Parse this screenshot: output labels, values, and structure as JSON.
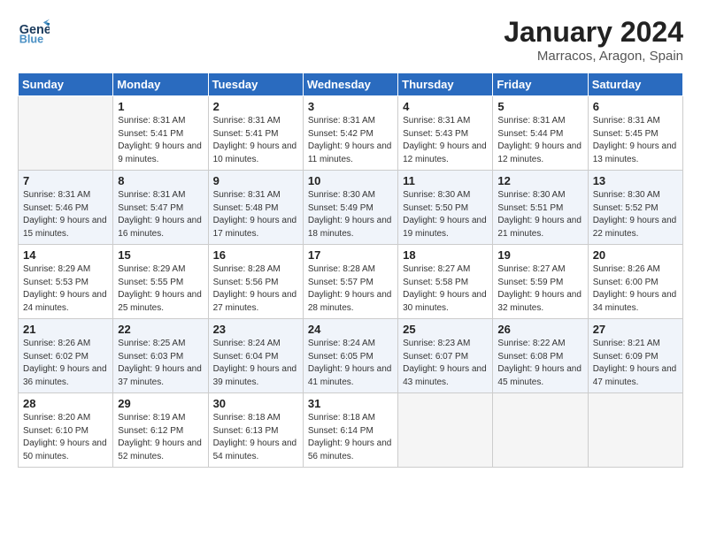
{
  "header": {
    "logo_line1": "General",
    "logo_line2": "Blue",
    "title": "January 2024",
    "subtitle": "Marracos, Aragon, Spain"
  },
  "calendar": {
    "days": [
      "Sunday",
      "Monday",
      "Tuesday",
      "Wednesday",
      "Thursday",
      "Friday",
      "Saturday"
    ],
    "rows": [
      [
        {
          "day": "",
          "empty": true
        },
        {
          "day": "1",
          "sunrise": "Sunrise: 8:31 AM",
          "sunset": "Sunset: 5:41 PM",
          "daylight": "Daylight: 9 hours and 9 minutes."
        },
        {
          "day": "2",
          "sunrise": "Sunrise: 8:31 AM",
          "sunset": "Sunset: 5:41 PM",
          "daylight": "Daylight: 9 hours and 10 minutes."
        },
        {
          "day": "3",
          "sunrise": "Sunrise: 8:31 AM",
          "sunset": "Sunset: 5:42 PM",
          "daylight": "Daylight: 9 hours and 11 minutes."
        },
        {
          "day": "4",
          "sunrise": "Sunrise: 8:31 AM",
          "sunset": "Sunset: 5:43 PM",
          "daylight": "Daylight: 9 hours and 12 minutes."
        },
        {
          "day": "5",
          "sunrise": "Sunrise: 8:31 AM",
          "sunset": "Sunset: 5:44 PM",
          "daylight": "Daylight: 9 hours and 12 minutes."
        },
        {
          "day": "6",
          "sunrise": "Sunrise: 8:31 AM",
          "sunset": "Sunset: 5:45 PM",
          "daylight": "Daylight: 9 hours and 13 minutes."
        }
      ],
      [
        {
          "day": "7",
          "sunrise": "Sunrise: 8:31 AM",
          "sunset": "Sunset: 5:46 PM",
          "daylight": "Daylight: 9 hours and 15 minutes."
        },
        {
          "day": "8",
          "sunrise": "Sunrise: 8:31 AM",
          "sunset": "Sunset: 5:47 PM",
          "daylight": "Daylight: 9 hours and 16 minutes."
        },
        {
          "day": "9",
          "sunrise": "Sunrise: 8:31 AM",
          "sunset": "Sunset: 5:48 PM",
          "daylight": "Daylight: 9 hours and 17 minutes."
        },
        {
          "day": "10",
          "sunrise": "Sunrise: 8:30 AM",
          "sunset": "Sunset: 5:49 PM",
          "daylight": "Daylight: 9 hours and 18 minutes."
        },
        {
          "day": "11",
          "sunrise": "Sunrise: 8:30 AM",
          "sunset": "Sunset: 5:50 PM",
          "daylight": "Daylight: 9 hours and 19 minutes."
        },
        {
          "day": "12",
          "sunrise": "Sunrise: 8:30 AM",
          "sunset": "Sunset: 5:51 PM",
          "daylight": "Daylight: 9 hours and 21 minutes."
        },
        {
          "day": "13",
          "sunrise": "Sunrise: 8:30 AM",
          "sunset": "Sunset: 5:52 PM",
          "daylight": "Daylight: 9 hours and 22 minutes."
        }
      ],
      [
        {
          "day": "14",
          "sunrise": "Sunrise: 8:29 AM",
          "sunset": "Sunset: 5:53 PM",
          "daylight": "Daylight: 9 hours and 24 minutes."
        },
        {
          "day": "15",
          "sunrise": "Sunrise: 8:29 AM",
          "sunset": "Sunset: 5:55 PM",
          "daylight": "Daylight: 9 hours and 25 minutes."
        },
        {
          "day": "16",
          "sunrise": "Sunrise: 8:28 AM",
          "sunset": "Sunset: 5:56 PM",
          "daylight": "Daylight: 9 hours and 27 minutes."
        },
        {
          "day": "17",
          "sunrise": "Sunrise: 8:28 AM",
          "sunset": "Sunset: 5:57 PM",
          "daylight": "Daylight: 9 hours and 28 minutes."
        },
        {
          "day": "18",
          "sunrise": "Sunrise: 8:27 AM",
          "sunset": "Sunset: 5:58 PM",
          "daylight": "Daylight: 9 hours and 30 minutes."
        },
        {
          "day": "19",
          "sunrise": "Sunrise: 8:27 AM",
          "sunset": "Sunset: 5:59 PM",
          "daylight": "Daylight: 9 hours and 32 minutes."
        },
        {
          "day": "20",
          "sunrise": "Sunrise: 8:26 AM",
          "sunset": "Sunset: 6:00 PM",
          "daylight": "Daylight: 9 hours and 34 minutes."
        }
      ],
      [
        {
          "day": "21",
          "sunrise": "Sunrise: 8:26 AM",
          "sunset": "Sunset: 6:02 PM",
          "daylight": "Daylight: 9 hours and 36 minutes."
        },
        {
          "day": "22",
          "sunrise": "Sunrise: 8:25 AM",
          "sunset": "Sunset: 6:03 PM",
          "daylight": "Daylight: 9 hours and 37 minutes."
        },
        {
          "day": "23",
          "sunrise": "Sunrise: 8:24 AM",
          "sunset": "Sunset: 6:04 PM",
          "daylight": "Daylight: 9 hours and 39 minutes."
        },
        {
          "day": "24",
          "sunrise": "Sunrise: 8:24 AM",
          "sunset": "Sunset: 6:05 PM",
          "daylight": "Daylight: 9 hours and 41 minutes."
        },
        {
          "day": "25",
          "sunrise": "Sunrise: 8:23 AM",
          "sunset": "Sunset: 6:07 PM",
          "daylight": "Daylight: 9 hours and 43 minutes."
        },
        {
          "day": "26",
          "sunrise": "Sunrise: 8:22 AM",
          "sunset": "Sunset: 6:08 PM",
          "daylight": "Daylight: 9 hours and 45 minutes."
        },
        {
          "day": "27",
          "sunrise": "Sunrise: 8:21 AM",
          "sunset": "Sunset: 6:09 PM",
          "daylight": "Daylight: 9 hours and 47 minutes."
        }
      ],
      [
        {
          "day": "28",
          "sunrise": "Sunrise: 8:20 AM",
          "sunset": "Sunset: 6:10 PM",
          "daylight": "Daylight: 9 hours and 50 minutes."
        },
        {
          "day": "29",
          "sunrise": "Sunrise: 8:19 AM",
          "sunset": "Sunset: 6:12 PM",
          "daylight": "Daylight: 9 hours and 52 minutes."
        },
        {
          "day": "30",
          "sunrise": "Sunrise: 8:18 AM",
          "sunset": "Sunset: 6:13 PM",
          "daylight": "Daylight: 9 hours and 54 minutes."
        },
        {
          "day": "31",
          "sunrise": "Sunrise: 8:18 AM",
          "sunset": "Sunset: 6:14 PM",
          "daylight": "Daylight: 9 hours and 56 minutes."
        },
        {
          "day": "",
          "empty": true
        },
        {
          "day": "",
          "empty": true
        },
        {
          "day": "",
          "empty": true
        }
      ]
    ]
  }
}
